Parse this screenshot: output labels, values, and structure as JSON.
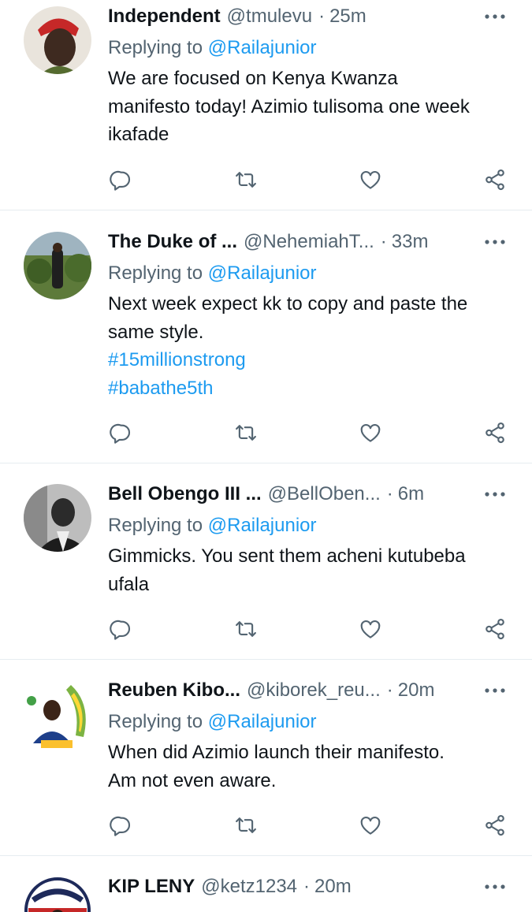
{
  "tweets": [
    {
      "name": "Independent",
      "handle": "@tmulevu",
      "time": "25m",
      "replying_prefix": "Replying to",
      "replying_to": "@Railajunior",
      "lines": [
        "We are focused on Kenya Kwanza",
        "manifesto today! Azimio tulisoma one week",
        "ikafade"
      ],
      "hashtags": []
    },
    {
      "name": "The Duke of ...",
      "handle": "@NehemiahT...",
      "time": "33m",
      "replying_prefix": "Replying to",
      "replying_to": "@Railajunior",
      "lines": [
        "Next week expect kk to copy and paste the",
        "same  style."
      ],
      "hashtags": [
        "#15millionstrong",
        "#babathe5th"
      ]
    },
    {
      "name": "Bell Obengo III ...",
      "handle": "@BellOben...",
      "time": "6m",
      "replying_prefix": "Replying to",
      "replying_to": "@Railajunior",
      "lines": [
        "Gimmicks. You sent them acheni kutubeba",
        "ufala"
      ],
      "hashtags": []
    },
    {
      "name": "Reuben Kibo...",
      "handle": "@kiborek_reu...",
      "time": "20m",
      "replying_prefix": "Replying to",
      "replying_to": "@Railajunior",
      "lines": [
        "When did Azimio launch their manifesto.",
        "Am not even aware."
      ],
      "hashtags": []
    },
    {
      "name": "KIP LENY",
      "handle": "@ketz1234",
      "time": "20m",
      "replying_prefix": "",
      "replying_to": "",
      "lines": [],
      "hashtags": []
    }
  ],
  "icons": {
    "reply": "reply-icon",
    "retweet": "retweet-icon",
    "like": "like-icon",
    "share": "share-icon",
    "more": "more-icon"
  },
  "colors": {
    "text": "#0f1419",
    "secondary": "#536471",
    "link": "#1d9bf0",
    "divider": "#e6ecf0"
  }
}
